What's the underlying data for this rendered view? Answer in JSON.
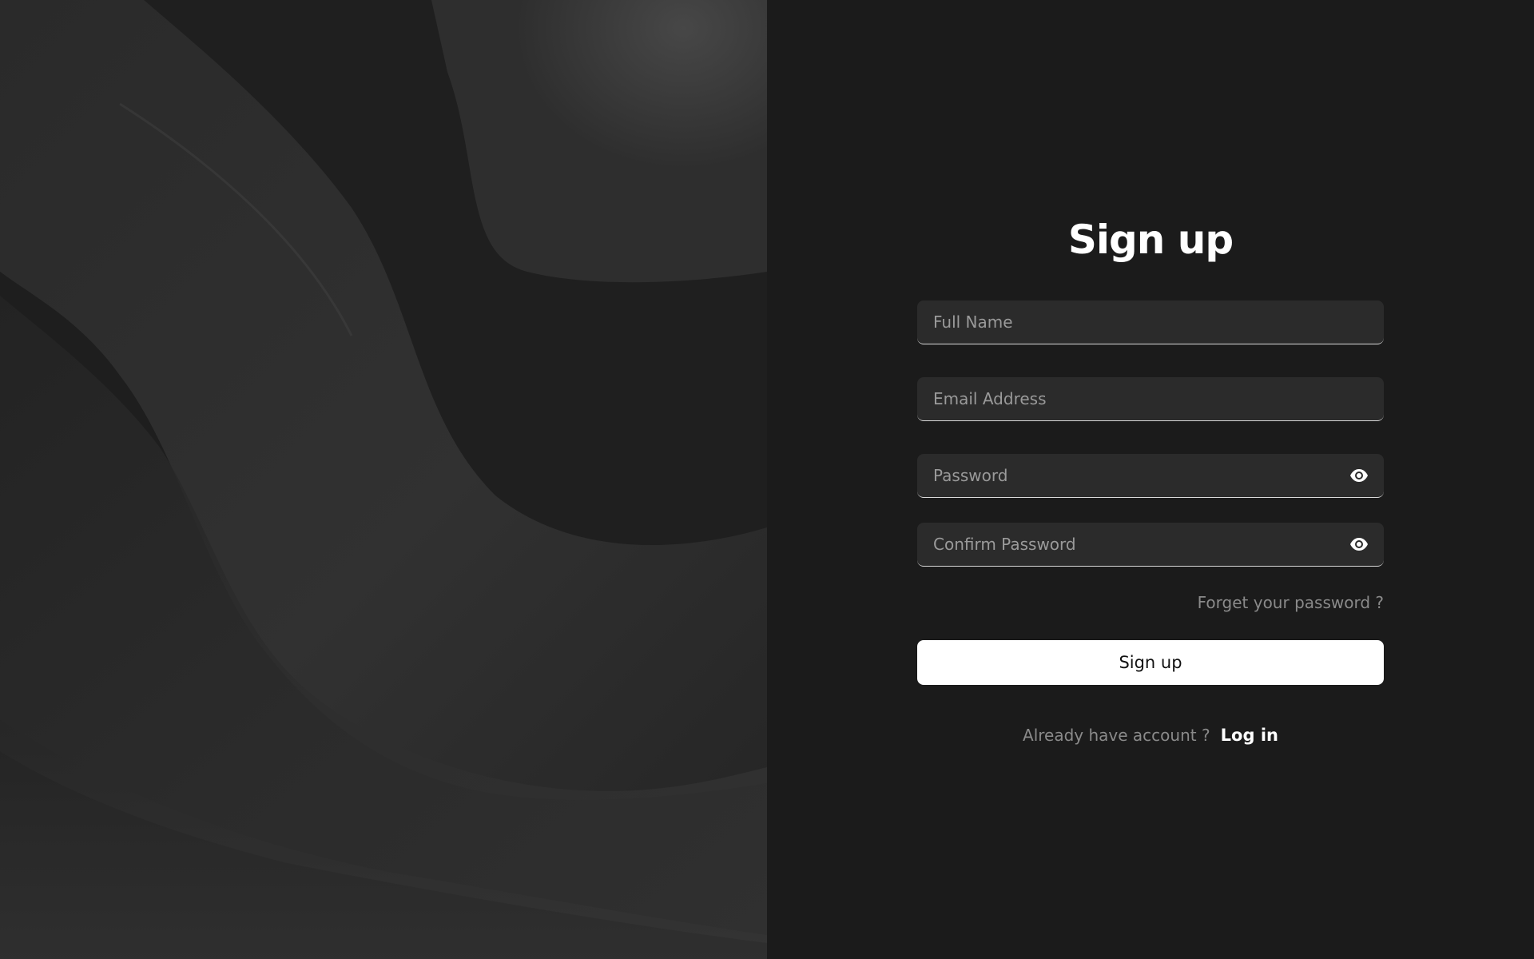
{
  "colors": {
    "background": "#1b1b1b",
    "field_background": "#2b2b2b",
    "button_background": "#ffffff",
    "muted_text": "#8a8a8a",
    "accent_text": "#ffffff"
  },
  "hero": {
    "icon": "abstract-waves-artwork"
  },
  "signup": {
    "title": "Sign up",
    "fields": {
      "full_name": {
        "placeholder": "Full Name",
        "value": ""
      },
      "email": {
        "placeholder": "Email Address",
        "value": ""
      },
      "password": {
        "placeholder": "Password",
        "value": "",
        "toggle_icon": "eye-icon"
      },
      "confirm_password": {
        "placeholder": "Confirm Password",
        "value": "",
        "toggle_icon": "eye-icon"
      }
    },
    "forgot_password_label": "Forget your password ?",
    "submit_label": "Sign up",
    "login_prompt": "Already have account ?",
    "login_link_label": "Log in"
  }
}
